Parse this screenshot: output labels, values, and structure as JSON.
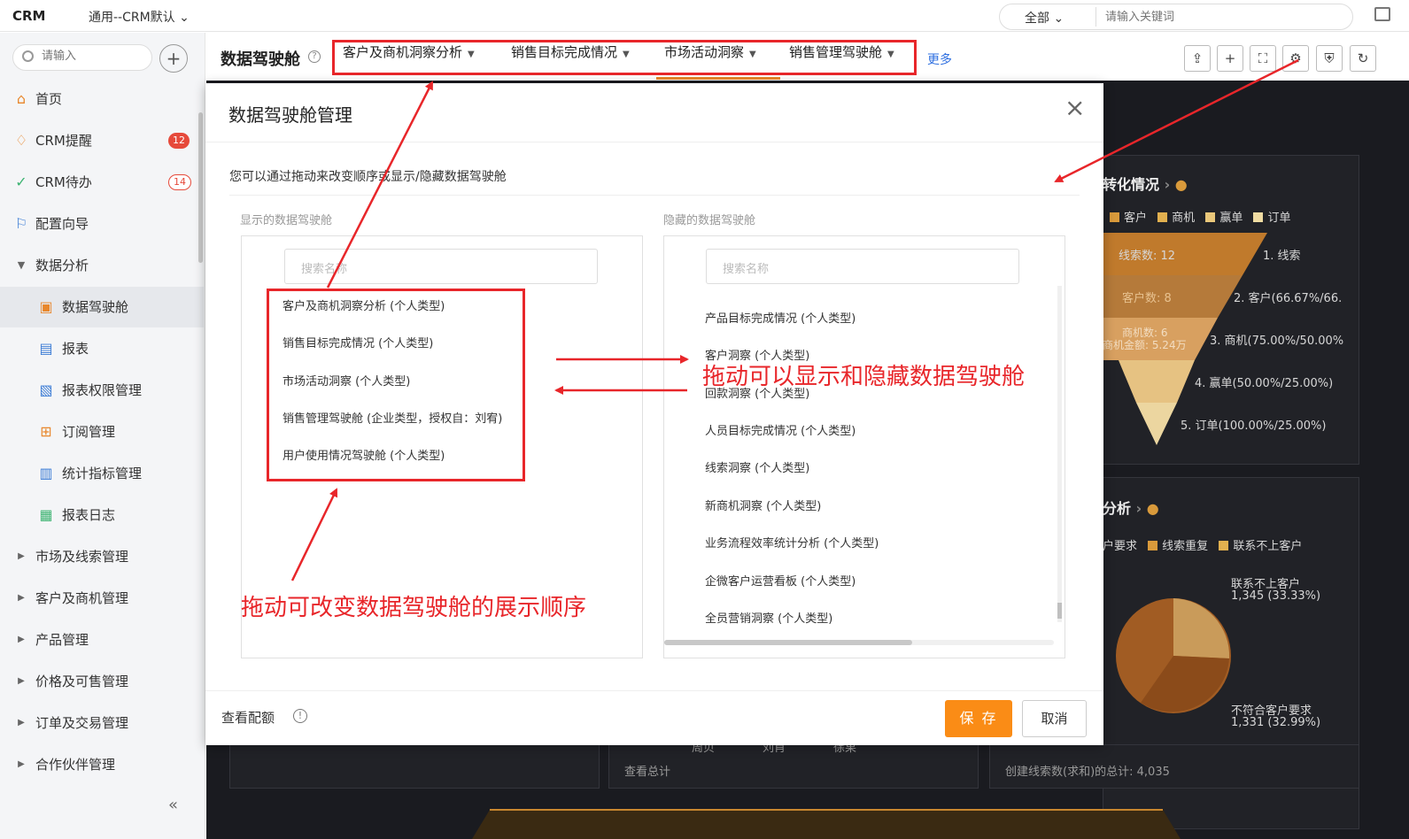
{
  "topbar": {
    "logo": "CRM",
    "app_switch": "通用--CRM默认",
    "search_scope": "全部",
    "search_placeholder": "请输入关键词"
  },
  "sidebar": {
    "search_placeholder": "请输入",
    "items": [
      {
        "label": "首页",
        "icon": "home-icon"
      },
      {
        "label": "CRM提醒",
        "icon": "bell-icon",
        "badge": "12"
      },
      {
        "label": "CRM待办",
        "icon": "check-circle-icon",
        "badge": "14"
      },
      {
        "label": "配置向导",
        "icon": "flag-icon"
      },
      {
        "label": "数据分析",
        "icon": "caret-down-icon"
      },
      {
        "label": "数据驾驶舱",
        "icon": "dashboard-icon"
      },
      {
        "label": "报表",
        "icon": "report-icon"
      },
      {
        "label": "报表权限管理",
        "icon": "report-permission-icon"
      },
      {
        "label": "订阅管理",
        "icon": "subscribe-icon"
      },
      {
        "label": "统计指标管理",
        "icon": "metric-icon"
      },
      {
        "label": "报表日志",
        "icon": "log-icon"
      },
      {
        "label": "市场及线索管理",
        "icon": "caret-right-icon"
      },
      {
        "label": "客户及商机管理",
        "icon": "caret-right-icon"
      },
      {
        "label": "产品管理",
        "icon": "caret-right-icon"
      },
      {
        "label": "价格及可售管理",
        "icon": "caret-right-icon"
      },
      {
        "label": "订单及交易管理",
        "icon": "caret-right-icon"
      },
      {
        "label": "合作伙伴管理",
        "icon": "caret-right-icon"
      }
    ],
    "collapse": "«"
  },
  "header": {
    "title": "数据驾驶舱",
    "tabs": [
      {
        "label": "客户及商机洞察分析"
      },
      {
        "label": "销售目标完成情况"
      },
      {
        "label": "市场活动洞察"
      },
      {
        "label": "销售管理驾驶舱"
      }
    ],
    "more": "更多"
  },
  "dashboard": {
    "funnel_title": "转化情况",
    "funnel_legend": [
      "客户",
      "商机",
      "赢单",
      "订单"
    ],
    "funnel_inner": [
      "线索数: 12",
      "客户数: 8",
      "商机数: 6",
      "商机金额: 5.24万"
    ],
    "funnel_labels": [
      "1. 线索",
      "2. 客户(66.67%/66.",
      "3. 商机(75.00%/50.00%",
      "4. 赢单(50.00%/25.00%)",
      "5. 订单(100.00%/25.00%)"
    ],
    "pie_title": "分析",
    "pie_legend": [
      "户要求",
      "线索重复",
      "联系不上客户"
    ],
    "pie_labels": [
      {
        "name": "联系不上客户",
        "value": "1,345 (33.33%)"
      },
      {
        "name": "不符合客户要求",
        "value": "1,331 (32.99%)"
      }
    ],
    "bottom_left": "查看总计",
    "bottom_axis": [
      "周贝",
      "刘肖",
      "徐果"
    ],
    "bottom_right": "创建线索数(求和)的总计: 4,035"
  },
  "modal": {
    "title": "数据驾驶舱管理",
    "description": "您可以通过拖动来改变顺序或显示/隐藏数据驾驶舱",
    "shown_label": "显示的数据驾驶舱",
    "hidden_label": "隐藏的数据驾驶舱",
    "search_placeholder": "搜索名称",
    "shown_items": [
      "客户及商机洞察分析 (个人类型)",
      "销售目标完成情况 (个人类型)",
      "市场活动洞察 (个人类型)",
      "销售管理驾驶舱 (企业类型，授权自：刘宥)",
      "用户使用情况驾驶舱 (个人类型)"
    ],
    "hidden_items": [
      "产品目标完成情况 (个人类型)",
      "客户洞察 (个人类型)",
      "回款洞察 (个人类型)",
      "人员目标完成情况 (个人类型)",
      "线索洞察 (个人类型)",
      "新商机洞察 (个人类型)",
      "业务流程效率统计分析 (个人类型)",
      "企微客户运营看板 (个人类型)",
      "全员营销洞察 (个人类型)"
    ],
    "quota": "查看配额",
    "save": "保 存",
    "cancel": "取消"
  },
  "annotations": {
    "show_hide": "拖动可以显示和隐藏数据驾驶舱",
    "reorder": "拖动可改变数据驾驶舱的展示顺序"
  },
  "colors": {
    "accent": "#fa8c16",
    "annotation": "#e8262a",
    "link": "#2e6fe0",
    "badge": "#e64a3b"
  }
}
